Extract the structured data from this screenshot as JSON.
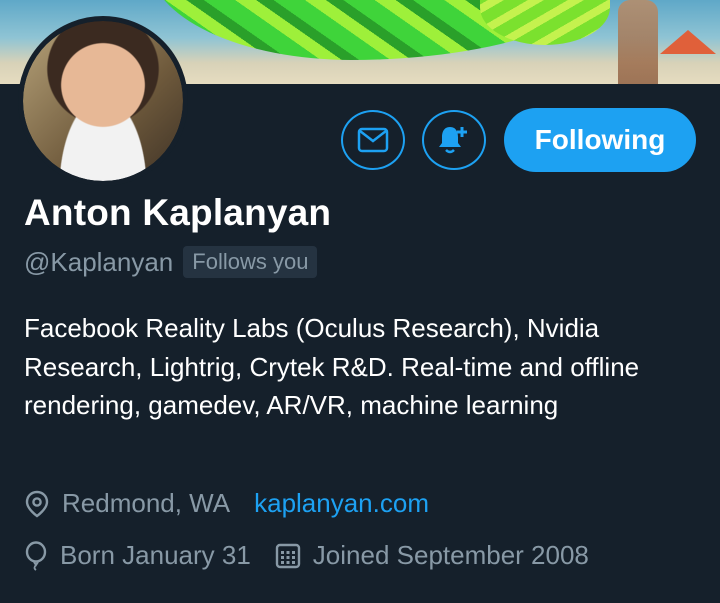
{
  "profile": {
    "name": "Anton Kaplanyan",
    "handle": "@Kaplanyan",
    "follows_you": "Follows you",
    "bio": "Facebook Reality Labs (Oculus Research), Nvidia Research, Lightrig, Crytek R&D. Real-time and offline rendering, gamedev, AR/VR, machine learning",
    "location": "Redmond, WA",
    "website": "kaplanyan.com",
    "birthday": "Born January 31",
    "joined": "Joined September 2008"
  },
  "actions": {
    "follow_label": "Following"
  },
  "icons": {
    "message": "mail-icon",
    "notify": "bell-plus-icon",
    "location": "location-pin-icon",
    "birthday": "balloon-icon",
    "joined": "calendar-icon"
  },
  "colors": {
    "background": "#15202b",
    "accent": "#1da1f2",
    "secondary_text": "#8899a6",
    "badge_bg": "#253341"
  }
}
